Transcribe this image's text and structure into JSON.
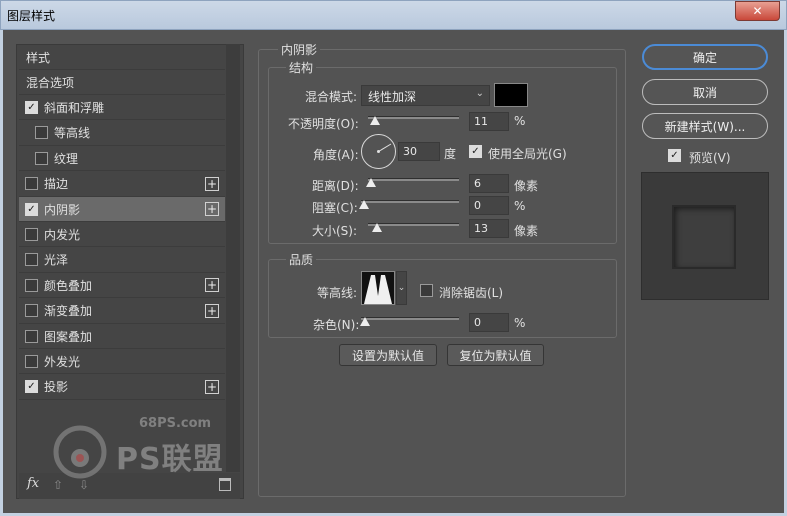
{
  "window": {
    "title": "图层样式",
    "close": "✕"
  },
  "left_panel": {
    "header": "样式",
    "items": [
      {
        "label": "混合选项"
      },
      {
        "label": "斜面和浮雕",
        "checked": true
      },
      {
        "label": "等高线",
        "checked": false
      },
      {
        "label": "纹理",
        "checked": false
      },
      {
        "label": "描边",
        "checked": false,
        "plus": "+"
      },
      {
        "label": "内阴影",
        "checked": true,
        "plus": "+"
      },
      {
        "label": "内发光",
        "checked": false
      },
      {
        "label": "光泽",
        "checked": false
      },
      {
        "label": "颜色叠加",
        "checked": false,
        "plus": "+"
      },
      {
        "label": "渐变叠加",
        "checked": false,
        "plus": "+"
      },
      {
        "label": "图案叠加",
        "checked": false
      },
      {
        "label": "外发光",
        "checked": false
      },
      {
        "label": "投影",
        "checked": true,
        "plus": "+"
      }
    ],
    "fx_label": "fx",
    "up_icon": "⇧",
    "down_icon": "⇩",
    "trash_icon": "trash-icon"
  },
  "inner_shadow": {
    "section_title": "内阴影",
    "structure": {
      "title": "结构",
      "blend_label": "混合模式:",
      "blend_value": "线性加深",
      "shadow_color": "#000000",
      "opacity_label": "不透明度(O):",
      "opacity_value": "11",
      "opacity_unit": "%",
      "angle_label": "角度(A):",
      "angle_value": "30",
      "angle_unit": "度",
      "global_light_label": "使用全局光(G)",
      "global_light_checked": true,
      "distance_label": "距离(D):",
      "distance_value": "6",
      "distance_unit": "像素",
      "choke_label": "阻塞(C):",
      "choke_value": "0",
      "choke_unit": "%",
      "size_label": "大小(S):",
      "size_value": "13",
      "size_unit": "像素"
    },
    "quality": {
      "title": "品质",
      "contour_label": "等高线:",
      "antialias_label": "消除锯齿(L)",
      "antialias_checked": false,
      "noise_label": "杂色(N):",
      "noise_value": "0",
      "noise_unit": "%"
    },
    "set_default": "设置为默认值",
    "reset_default": "复位为默认值"
  },
  "right_panel": {
    "ok": "确定",
    "cancel": "取消",
    "new_style": "新建样式(W)...",
    "preview_label": "预览(V)",
    "preview_checked": true
  },
  "watermark": {
    "site": "68PS.com",
    "brand": "PS联盟"
  }
}
